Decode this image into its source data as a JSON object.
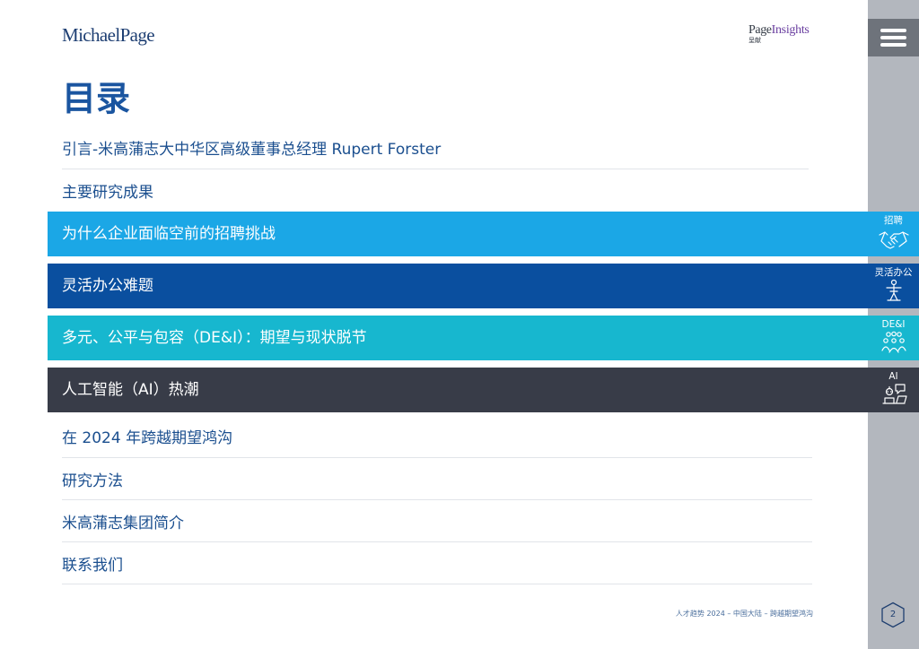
{
  "header": {
    "brand_logo": "MichaelPage",
    "partner_logo_main": "Page",
    "partner_logo_accent": "Insights",
    "partner_logo_sub": "呈献"
  },
  "page_title": "目录",
  "toc": {
    "intro": "引言-米高蒲志大中华区高级董事总经理 Rupert Forster",
    "key_findings": "主要研究成果",
    "section_recruiting": "为什么企业面临空前的招聘挑战",
    "section_flexible": "灵活办公难题",
    "section_dei": "多元、公平与包容（DE&I）：期望与现状脱节",
    "section_ai": "人工智能（AI）热潮",
    "bridge_gap": "在 2024 年跨越期望鸿沟",
    "methodology": "研究方法",
    "about": "米高蒲志集团简介",
    "contact": "联系我们"
  },
  "sidebar": {
    "menu_icon": "hamburger-menu-icon",
    "tabs": [
      {
        "label": "招聘",
        "icon": "handshake-icon",
        "color": "#1ba7e6"
      },
      {
        "label": "灵活办公",
        "icon": "person-figure-icon",
        "color": "#0a4f9f"
      },
      {
        "label": "DE&I",
        "icon": "group-icon",
        "color": "#17b7cf"
      },
      {
        "label": "AI",
        "icon": "robot-chat-icon",
        "color": "#383c48"
      }
    ]
  },
  "footer": {
    "text": "人才趋势 2024 – 中国大陆 – 跨越期望鸿沟",
    "page_number": "2"
  },
  "colors": {
    "recruiting": "#1ba7e6",
    "flexible": "#0a4f9f",
    "dei": "#17b7cf",
    "ai": "#383c48",
    "sidebar": "#b3b7be",
    "title": "#1a55a0"
  }
}
